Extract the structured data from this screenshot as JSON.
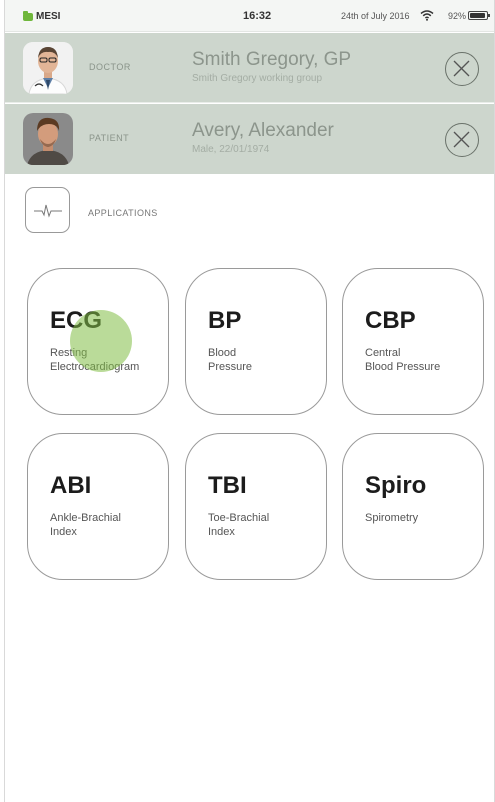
{
  "status_bar": {
    "app": "MESI",
    "time": "16:32",
    "date": "24th of July 2016",
    "battery": "92%",
    "battery_level": 0.92
  },
  "doctor": {
    "role": "DOCTOR",
    "name": "Smith Gregory, GP",
    "sub": "Smith Gregory working group"
  },
  "patient": {
    "role": "PATIENT",
    "name": "Avery, Alexander",
    "sub": "Male, 22/01/1974"
  },
  "applications": {
    "label": "APPLICATIONS",
    "tiles": [
      {
        "abbr": "ECG",
        "line1": "Resting",
        "line2": "Electrocardiogram"
      },
      {
        "abbr": "BP",
        "line1": "Blood",
        "line2": "Pressure"
      },
      {
        "abbr": "CBP",
        "line1": "Central",
        "line2": "Blood Pressure"
      },
      {
        "abbr": "ABI",
        "line1": "Ankle-Brachial",
        "line2": "Index"
      },
      {
        "abbr": "TBI",
        "line1": "Toe-Brachial",
        "line2": "Index"
      },
      {
        "abbr": "Spiro",
        "line1": "Spirometry",
        "line2": ""
      }
    ]
  },
  "colors": {
    "accent_green": "#6fb73b",
    "header_bg": "#cdd6cd"
  }
}
